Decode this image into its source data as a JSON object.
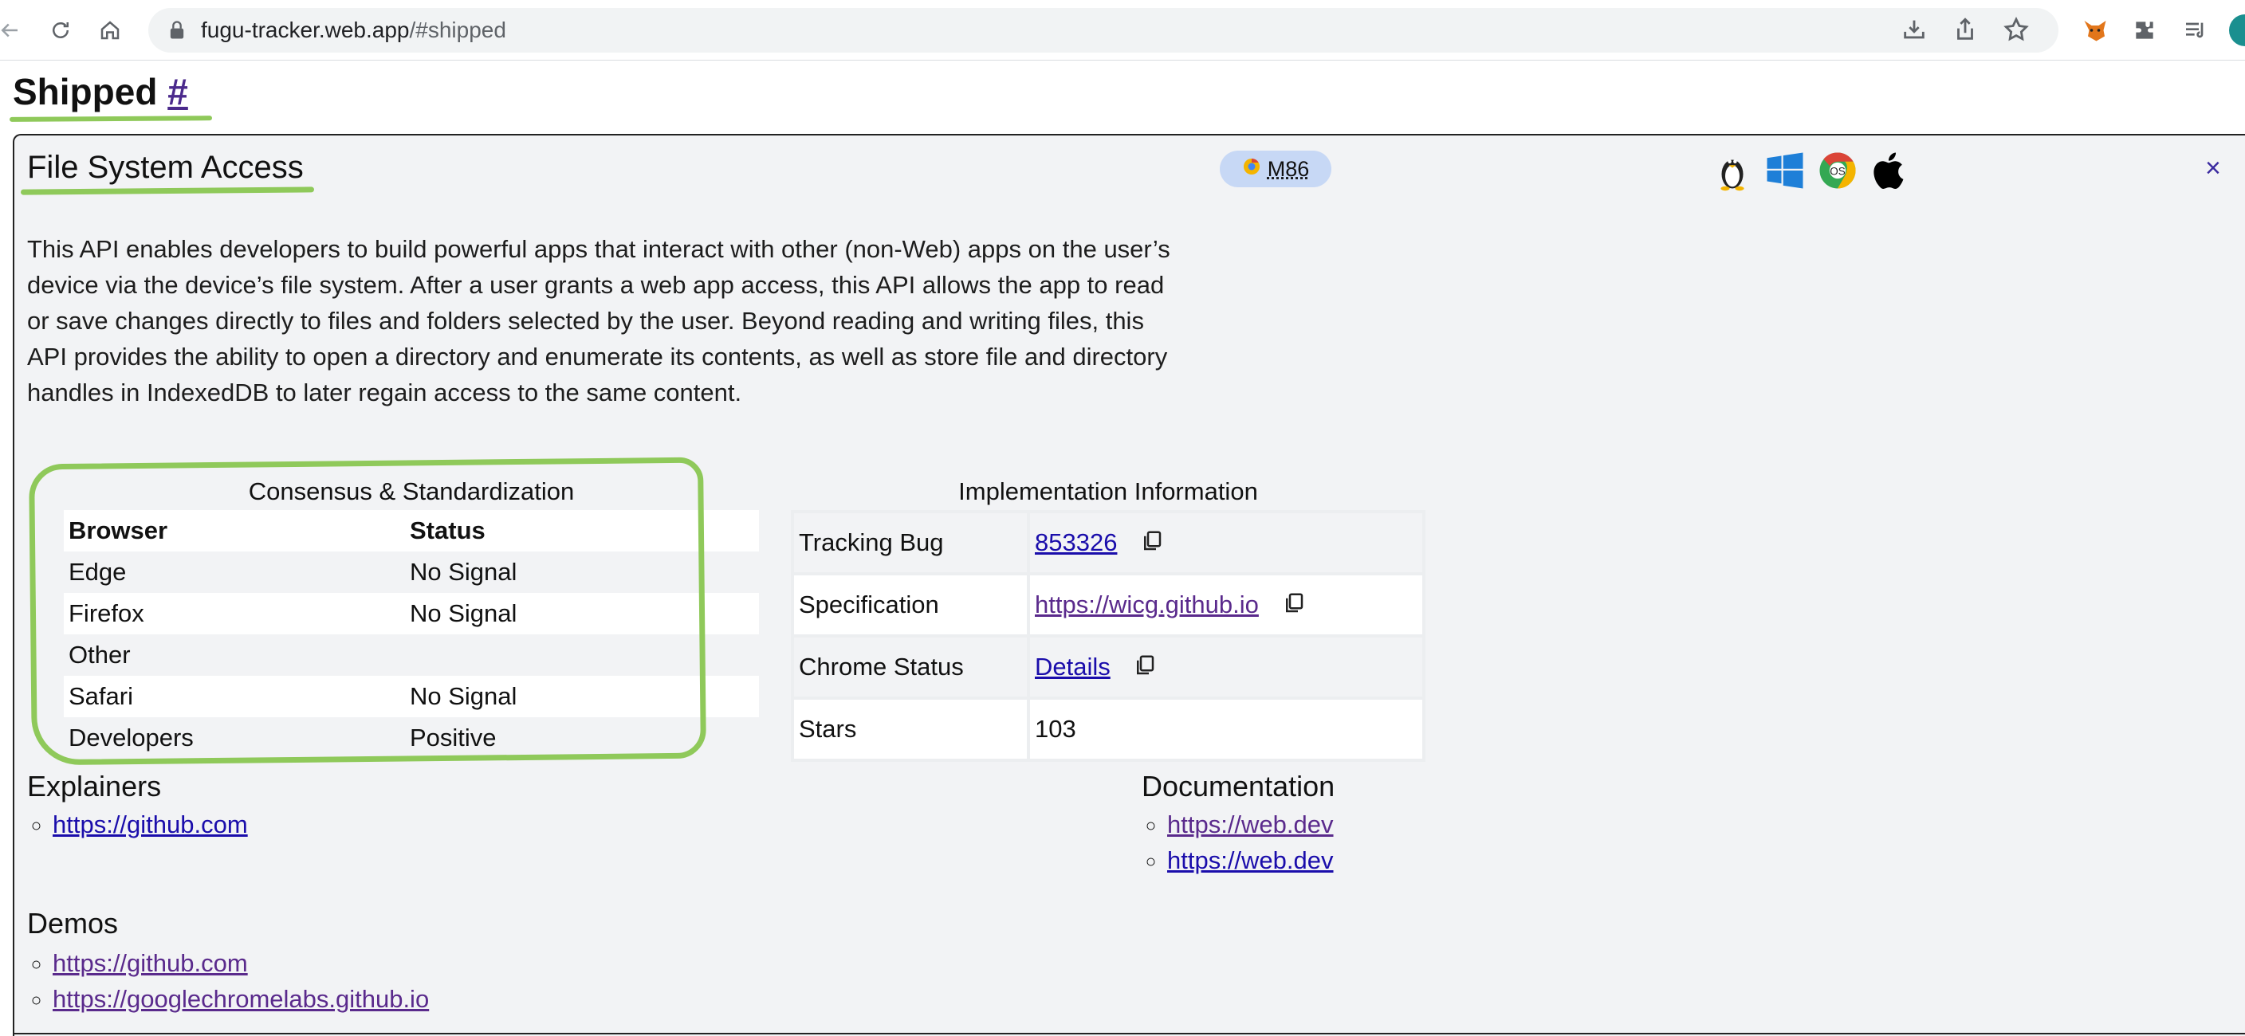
{
  "browser": {
    "url_host": "fugu-tracker.web.app",
    "url_path": "/#shipped",
    "icons": [
      "back-arrow-icon",
      "reload-icon",
      "home-icon",
      "lock-icon",
      "install-icon",
      "share-icon",
      "star-icon",
      "fox-extension-icon",
      "puzzle-extension-icon",
      "reading-list-icon"
    ]
  },
  "page": {
    "heading": "Shipped",
    "anchor": "#"
  },
  "feature": {
    "title": "File System Access",
    "milestone": "M86",
    "milestone_icon": "chrome-milestone-icon",
    "os_icons": [
      "linux-icon",
      "windows-icon",
      "chrome-os-icon",
      "apple-icon"
    ],
    "close_label": "×",
    "description": "This API enables developers to build powerful apps that interact with other (non-Web) apps on the user’s device via the device’s file system. After a user grants a web app access, this API allows the app to read or save changes directly to files and folders selected by the user. Beyond reading and writing files, this API provides the ability to open a directory and enumerate its contents, as well as store file and directory handles in IndexedDB to later regain access to the same content."
  },
  "consensus": {
    "caption": "Consensus & Standardization",
    "headers": [
      "Browser",
      "Status"
    ],
    "rows": [
      {
        "browser": "Edge",
        "status": "No Signal"
      },
      {
        "browser": "Firefox",
        "status": "No Signal"
      },
      {
        "browser": "Other",
        "status": ""
      },
      {
        "browser": "Safari",
        "status": "No Signal"
      },
      {
        "browser": "Developers",
        "status": "Positive"
      }
    ]
  },
  "implementation": {
    "caption": "Implementation Information",
    "rows": [
      {
        "label": "Tracking Bug",
        "value": "853326"
      },
      {
        "label": "Specification",
        "value": "https://wicg.github.io"
      },
      {
        "label": "Chrome Status",
        "value": "Details"
      },
      {
        "label": "Stars",
        "value": "103"
      }
    ]
  },
  "explainers": {
    "title": "Explainers",
    "links": [
      "https://github.com"
    ]
  },
  "documentation": {
    "title": "Documentation",
    "links": [
      "https://web.dev",
      "https://web.dev"
    ]
  },
  "demos": {
    "title": "Demos",
    "links": [
      "https://github.com",
      "https://googlechromelabs.github.io"
    ]
  },
  "colors": {
    "highlight_green": "#8fc95a",
    "milestone_pill": "#c7d8f5",
    "link": "#1a0dab",
    "visited_link": "#5a2a8c",
    "card_background": "#f2f3f5"
  }
}
